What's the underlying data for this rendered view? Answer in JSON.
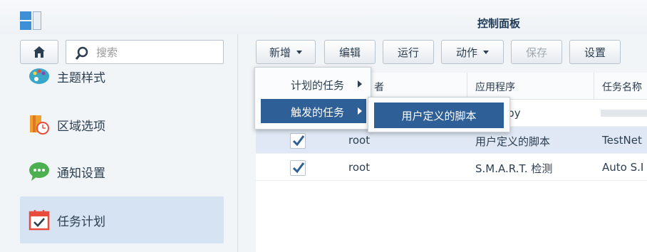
{
  "window": {
    "title": "控制面板"
  },
  "search": {
    "placeholder": "搜索"
  },
  "sidebar": {
    "items": [
      {
        "label": "主题样式",
        "icon": "palette-icon"
      },
      {
        "label": "区域选项",
        "icon": "region-clock-icon"
      },
      {
        "label": "通知设置",
        "icon": "chat-bubble-icon"
      },
      {
        "label": "任务计划",
        "icon": "calendar-check-icon",
        "active": true
      }
    ]
  },
  "toolbar": {
    "new_label": "新增",
    "edit_label": "编辑",
    "run_label": "运行",
    "action_label": "动作",
    "save_label": "保存",
    "settings_label": "设置"
  },
  "table": {
    "headers": [
      "者",
      "应用程序",
      "任务名称"
    ],
    "rows": [
      {
        "checked": false,
        "owner": "",
        "app": "opy",
        "task": ""
      },
      {
        "checked": true,
        "owner": "root",
        "app": "用户定义的脚本",
        "task": "TestNet",
        "selected": true
      },
      {
        "checked": true,
        "owner": "root",
        "app": "S.M.A.R.T. 检测",
        "task": "Auto S.I"
      }
    ]
  },
  "new_menu": {
    "items": [
      {
        "label": "计划的任务",
        "active": false
      },
      {
        "label": "触发的任务",
        "active": true
      }
    ]
  },
  "submenu": {
    "items": [
      {
        "label": "用户定义的脚本"
      }
    ]
  },
  "colors": {
    "accent": "#2e5f96",
    "selection": "#dfe8f4",
    "sidebar_active": "#d5e3f3"
  }
}
